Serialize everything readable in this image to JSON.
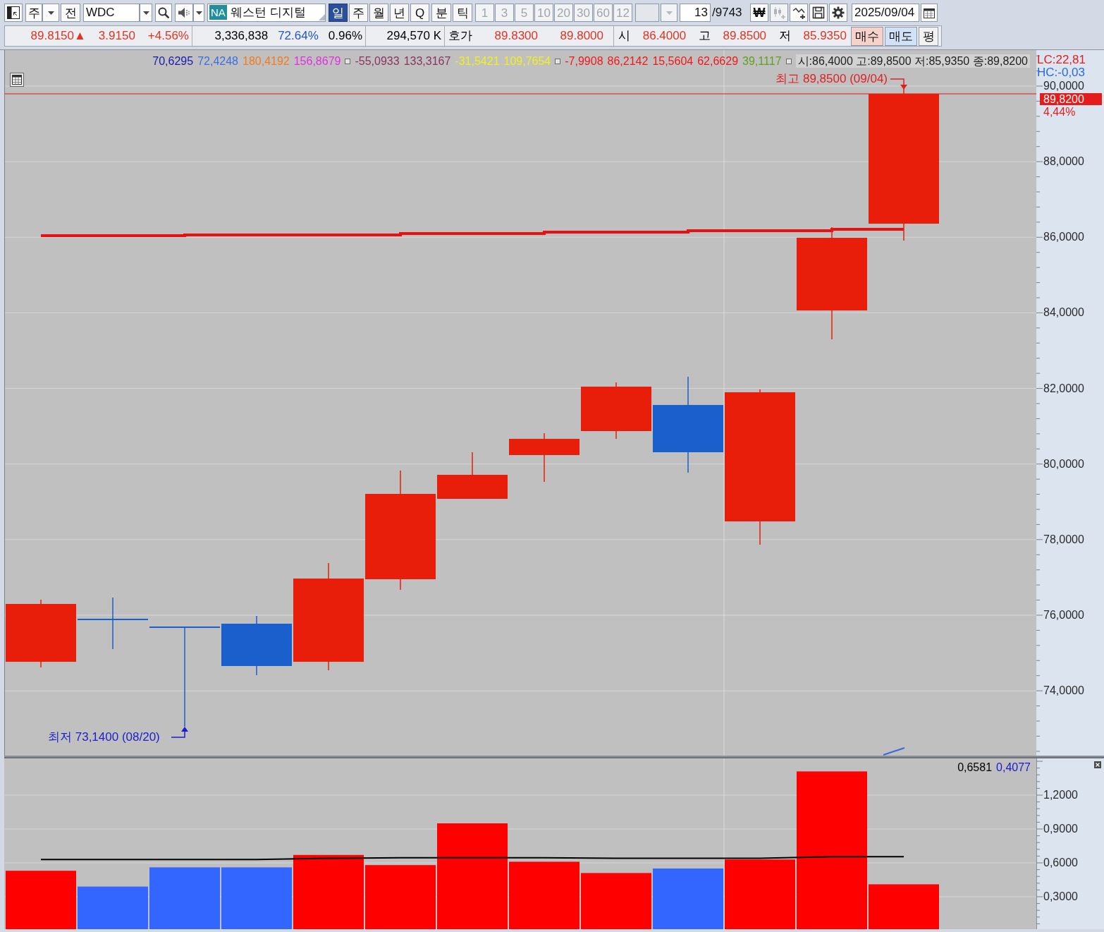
{
  "toolbar": {
    "market": {
      "value": "주"
    },
    "all_button": {
      "label": "전"
    },
    "symbol": {
      "value": "WDC"
    },
    "name": {
      "badge": "NA",
      "value": "웨스턴 디지털"
    },
    "periods": [
      {
        "label": "일",
        "selected": true
      },
      {
        "label": "주",
        "selected": false
      },
      {
        "label": "월",
        "selected": false
      },
      {
        "label": "년",
        "selected": false
      },
      {
        "label": "Q",
        "selected": false
      }
    ],
    "units": [
      {
        "label": "분",
        "selected": false
      },
      {
        "label": "틱",
        "selected": false
      }
    ],
    "intervals": [
      {
        "label": "1",
        "disabled": true
      },
      {
        "label": "3",
        "disabled": true
      },
      {
        "label": "5",
        "disabled": true
      },
      {
        "label": "10",
        "disabled": true
      },
      {
        "label": "20",
        "disabled": true
      },
      {
        "label": "30",
        "disabled": true
      },
      {
        "label": "60",
        "disabled": true
      },
      {
        "label": "12",
        "disabled": true
      }
    ],
    "custom_interval": {
      "disabled": true
    },
    "count": {
      "value": "13",
      "total": "/9743"
    },
    "currency_button": {
      "label": "₩"
    },
    "tools": [
      {
        "kind": "candles",
        "disabled": true
      },
      {
        "kind": "line-add",
        "disabled": false
      },
      {
        "kind": "save",
        "disabled": false
      },
      {
        "kind": "settings",
        "disabled": false
      }
    ],
    "date": {
      "value": "2025/09/04"
    }
  },
  "quote_bar": {
    "groups": [
      [
        {
          "text": "89.8150▲",
          "color": "#e03424"
        },
        {
          "text": "3.9150",
          "color": "#e03424"
        },
        {
          "text": "+4.56%",
          "color": "#e03424"
        }
      ],
      [
        {
          "text": "3,336,838",
          "color": "#000000"
        },
        {
          "text": "72.64%",
          "color": "#2454c8"
        },
        {
          "text": "0.96%",
          "color": "#000000"
        }
      ],
      [
        {
          "text": "294,570 K",
          "color": "#000000"
        }
      ],
      [
        {
          "text": "호가",
          "color": "#000000"
        },
        {
          "text": "89.8300",
          "color": "#e03424"
        },
        {
          "text": "89.8000",
          "color": "#e03424"
        }
      ],
      [
        {
          "text": "시",
          "color": "#000000"
        },
        {
          "text": "86.4000",
          "color": "#e03424"
        },
        {
          "text": "고",
          "color": "#000000"
        },
        {
          "text": "89.8500",
          "color": "#e03424"
        },
        {
          "text": "저",
          "color": "#000000"
        },
        {
          "text": "85.9350",
          "color": "#e03424"
        }
      ]
    ],
    "buttons": [
      {
        "label": "매수",
        "kind": "buy"
      },
      {
        "label": "매도",
        "kind": "sell"
      },
      {
        "label": "평",
        "kind": "neutral"
      }
    ]
  },
  "price_chart": {
    "legend": [
      {
        "kind": "value",
        "text": "70,6295",
        "color": "#1818b0"
      },
      {
        "kind": "value",
        "text": "72,4248",
        "color": "#3a6fe0"
      },
      {
        "kind": "value",
        "text": "180,4192",
        "color": "#f07a20"
      },
      {
        "kind": "value",
        "text": "156,8679",
        "color": "#e030e0"
      },
      {
        "kind": "marker"
      },
      {
        "kind": "value",
        "text": "-55,0933",
        "color": "#8a3462"
      },
      {
        "kind": "value",
        "text": "133,3167",
        "color": "#8a3462"
      },
      {
        "kind": "value",
        "text": "-31,5421",
        "color": "#f0f020"
      },
      {
        "kind": "value",
        "text": "109,7654",
        "color": "#f0f020"
      },
      {
        "kind": "marker"
      },
      {
        "kind": "value",
        "text": "-7,9908",
        "color": "#f01818"
      },
      {
        "kind": "value",
        "text": "86,2142",
        "color": "#f01818"
      },
      {
        "kind": "value",
        "text": "15,5604",
        "color": "#f01818"
      },
      {
        "kind": "value",
        "text": "62,6629",
        "color": "#f01818"
      },
      {
        "kind": "value",
        "text": "39,1117",
        "color": "#60a020"
      },
      {
        "kind": "marker"
      },
      {
        "kind": "ohlc",
        "text": "시:86,4000 고:89,8500 저:85,9350 종:89,8200"
      }
    ],
    "axis_labels": [
      "90,0000",
      "88,0000",
      "86,0000",
      "84,0000",
      "82,0000",
      "80,0000",
      "78,0000",
      "76,0000",
      "74,0000"
    ],
    "lc": "LC:22,81",
    "hc": "HC:-0,03",
    "last_price": "89,8200",
    "last_change": "4,44%",
    "high_note": "최고 89,8500 (09/04)",
    "low_note": "최저 73,1400 (08/20)"
  },
  "volume_chart": {
    "legend": [
      {
        "text": "0,6581",
        "color": "#000000"
      },
      {
        "text": "0,4077",
        "color": "#1a1ad0"
      }
    ],
    "chart_data": {
      "type": "bar",
      "ylim": [
        0,
        1.525
      ],
      "yticks": [
        {
          "value": 0.3,
          "label": "0,3000"
        },
        {
          "value": 0.6,
          "label": "0,6000"
        },
        {
          "value": 0.9,
          "label": "0,9000"
        },
        {
          "value": 1.2,
          "label": "1,2000"
        }
      ],
      "grid": true,
      "series": [
        {
          "color": "#ff0000",
          "values": [
            0.53,
            null,
            null,
            null,
            0.67,
            0.58,
            0.95,
            0.61,
            0.51,
            null,
            0.63,
            1.41,
            0.41
          ]
        },
        {
          "color": "#3366ff",
          "values": [
            null,
            0.39,
            0.56,
            0.56,
            null,
            null,
            null,
            null,
            null,
            0.55,
            null,
            null,
            null
          ]
        },
        {
          "type": "line",
          "color": "#000000",
          "values": [
            0.63,
            0.63,
            0.63,
            0.63,
            0.64,
            0.645,
            0.645,
            0.645,
            0.64,
            0.64,
            0.64,
            0.655,
            0.655
          ]
        }
      ]
    }
  }
}
